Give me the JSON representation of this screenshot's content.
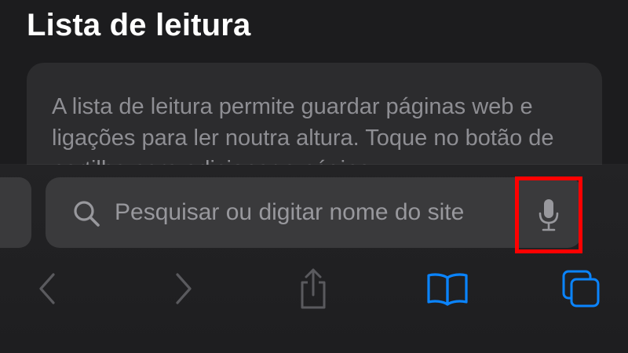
{
  "page": {
    "title": "Lista de leitura",
    "info_text": "A lista de leitura permite guardar páginas web e ligações para ler noutra altura. Toque no botão de partilha para adicionar a página"
  },
  "address_bar": {
    "placeholder": "Pesquisar ou digitar nome do site",
    "search_icon": "magnifying-glass-icon",
    "mic_icon": "microphone-icon",
    "highlight_color": "#ff0000"
  },
  "toolbar": {
    "items": [
      {
        "name": "back",
        "icon": "chevron-left-icon",
        "enabled": false
      },
      {
        "name": "forward",
        "icon": "chevron-right-icon",
        "enabled": false
      },
      {
        "name": "share",
        "icon": "share-icon",
        "enabled": false
      },
      {
        "name": "bookmarks",
        "icon": "book-icon",
        "enabled": true
      },
      {
        "name": "tabs",
        "icon": "tabs-icon",
        "enabled": true
      }
    ]
  },
  "colors": {
    "background": "#1c1c1e",
    "card": "#2c2c2e",
    "field": "#3a3a3c",
    "accent": "#0a84ff",
    "disabled": "#5a5a5e",
    "secondary_text": "#8e8e93"
  }
}
